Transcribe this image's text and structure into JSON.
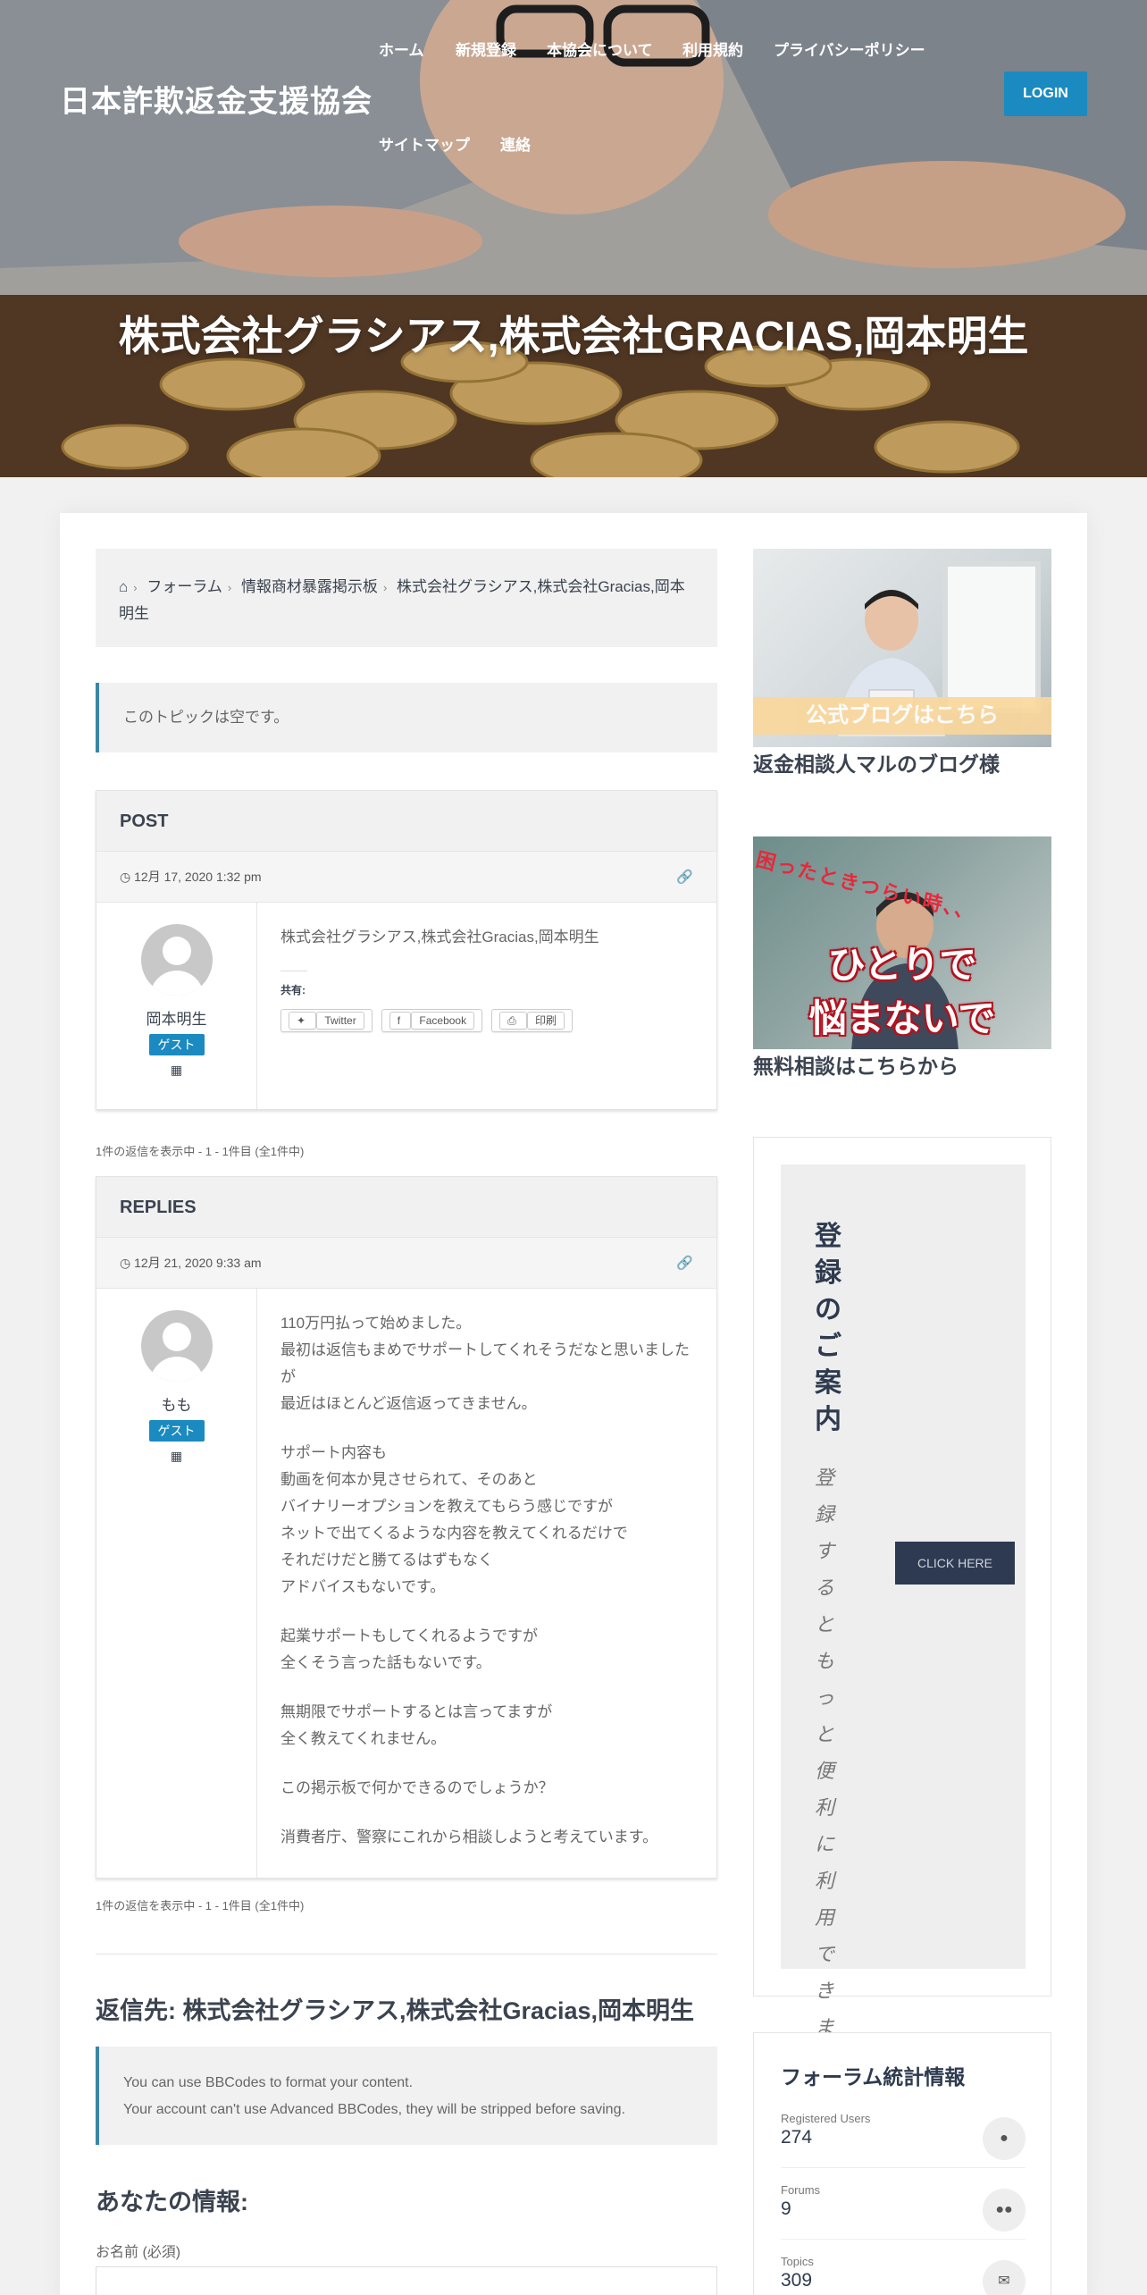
{
  "site": {
    "title": "日本詐欺返金支援協会",
    "nav": [
      "ホーム",
      "新規登録",
      "本協会について",
      "利用規約",
      "プライバシーポリシー",
      "サイトマップ",
      "連絡"
    ],
    "login_label": "LOGIN",
    "hero_title": "株式会社グラシアス,株式会社GRACIAS,岡本明生",
    "accent_color": "#1a8ac0"
  },
  "breadcrumb": {
    "home_icon": "home-icon",
    "items": [
      "フォーラム",
      "情報商材暴露掲示板",
      "株式会社グラシアス,株式会社Gracias,岡本明生"
    ]
  },
  "topic_notice": "このトピックは空です。",
  "post": {
    "header": "POST",
    "date": "12月 17, 2020 1:32 pm",
    "author": "岡本明生",
    "role": "ゲスト",
    "content": "株式会社グラシアス,株式会社Gracias,岡本明生",
    "share_label": "共有:",
    "share_buttons": [
      "Twitter",
      "Facebook",
      "印刷"
    ]
  },
  "count_text": "1件の返信を表示中 - 1 - 1件目 (全1件中)",
  "reply": {
    "header": "REPLIES",
    "date": "12月 21, 2020 9:33 am",
    "author": "もも",
    "role": "ゲスト",
    "paragraphs": [
      [
        "110万円払って始めました。",
        "最初は返信もまめでサポートしてくれそうだなと思いましたが",
        "最近はほとんど返信返ってきません。"
      ],
      [
        "サポート内容も",
        "動画を何本か見させられて、そのあと",
        "バイナリーオプションを教えてもらう感じですが",
        "ネットで出てくるような内容を教えてくれるだけで",
        "それだけだと勝てるはずもなく",
        "アドバイスもないです。"
      ],
      [
        "起業サポートもしてくれるようですが",
        "全くそう言った話もないです。"
      ],
      [
        "無期限でサポートするとは言ってますが",
        "全く教えてくれません。"
      ],
      [
        "この掲示板で何かできるのでしょうか？"
      ],
      [
        "消費者庁、警察にこれから相談しようと考えています。"
      ]
    ]
  },
  "reply_form": {
    "title": "返信先: 株式会社グラシアス,株式会社Gracias,岡本明生",
    "bbcode_lines": [
      "You can use BBCodes to format your content.",
      "Your account can't use Advanced BBCodes, they will be stripped before saving."
    ],
    "info_title": "あなたの情報:",
    "name_label": "お名前 (必須)"
  },
  "sidebar": {
    "banner1_text": "公式ブログはこちら",
    "banner1_caption": "返金相談人マルのブログ様",
    "banner2_top": "困ったときつらい時、、",
    "banner2_line1": "ひとりで",
    "banner2_line2": "悩まないで",
    "banner2_caption": "無料相談はこちらから",
    "register_title": "登録のご案内",
    "register_text": "登録するともっと便利に利用できます。",
    "register_button": "CLICK HERE",
    "stats_title": "フォーラム統計情報",
    "stats": [
      {
        "label": "Registered Users",
        "value": "274",
        "icon": "user-icon"
      },
      {
        "label": "Forums",
        "value": "9",
        "icon": "users-icon"
      },
      {
        "label": "Topics",
        "value": "309",
        "icon": "comments-icon"
      }
    ]
  }
}
